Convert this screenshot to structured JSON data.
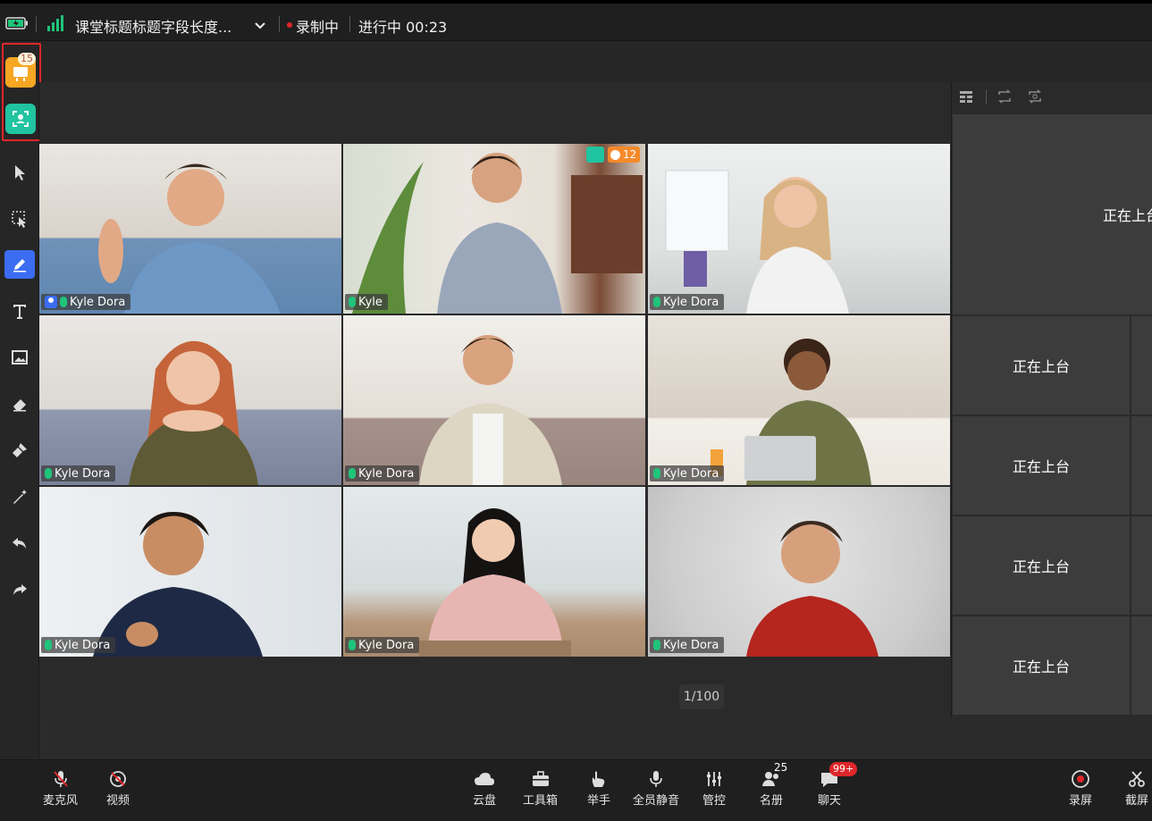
{
  "topbar": {
    "title": "课堂标题标题字段长度...",
    "recording": "录制中",
    "status": "进行中 00:23"
  },
  "left_apps": {
    "badge_count": "15"
  },
  "tools": [
    "pointer-icon",
    "selection-icon",
    "pen-icon",
    "text-icon",
    "image-icon",
    "eraser-icon",
    "brush-icon",
    "magic-icon",
    "undo-icon",
    "redo-icon"
  ],
  "tiles": [
    {
      "name": "Kyle Dora",
      "role_icon": true
    },
    {
      "name": "Kyle",
      "reward": "12"
    },
    {
      "name": "Kyle Dora"
    },
    {
      "name": "Kyle Dora"
    },
    {
      "name": "Kyle Dora"
    },
    {
      "name": "Kyle Dora"
    },
    {
      "name": "Kyle Dora"
    },
    {
      "name": "Kyle Dora"
    },
    {
      "name": "Kyle Dora"
    }
  ],
  "pager": "1/100",
  "right_panel": {
    "top_label": "正在上台",
    "cells": [
      "正在上台",
      "正在上台",
      "正在上台",
      "正在上台"
    ]
  },
  "bottom": {
    "left": [
      {
        "label": "麦克风",
        "icon": "mic-off-icon"
      },
      {
        "label": "视频",
        "icon": "camera-off-icon"
      }
    ],
    "center": [
      {
        "label": "云盘",
        "icon": "cloud-icon"
      },
      {
        "label": "工具箱",
        "icon": "toolbox-icon"
      },
      {
        "label": "举手",
        "icon": "hand-icon"
      },
      {
        "label": "全员静音",
        "icon": "mute-all-icon"
      },
      {
        "label": "管控",
        "icon": "sliders-icon"
      },
      {
        "label": "名册",
        "icon": "roster-icon",
        "count": "25"
      },
      {
        "label": "聊天",
        "icon": "chat-icon",
        "badge": "99+"
      }
    ],
    "right": [
      {
        "label": "录屏",
        "icon": "record-icon"
      },
      {
        "label": "截屏",
        "icon": "scissors-icon"
      }
    ]
  },
  "colors": {
    "accent_blue": "#3b6cf2",
    "record_red": "#e0262a",
    "mic_green": "#1fc47a",
    "app_orange": "#f5a623",
    "app_teal": "#21c4a0"
  }
}
